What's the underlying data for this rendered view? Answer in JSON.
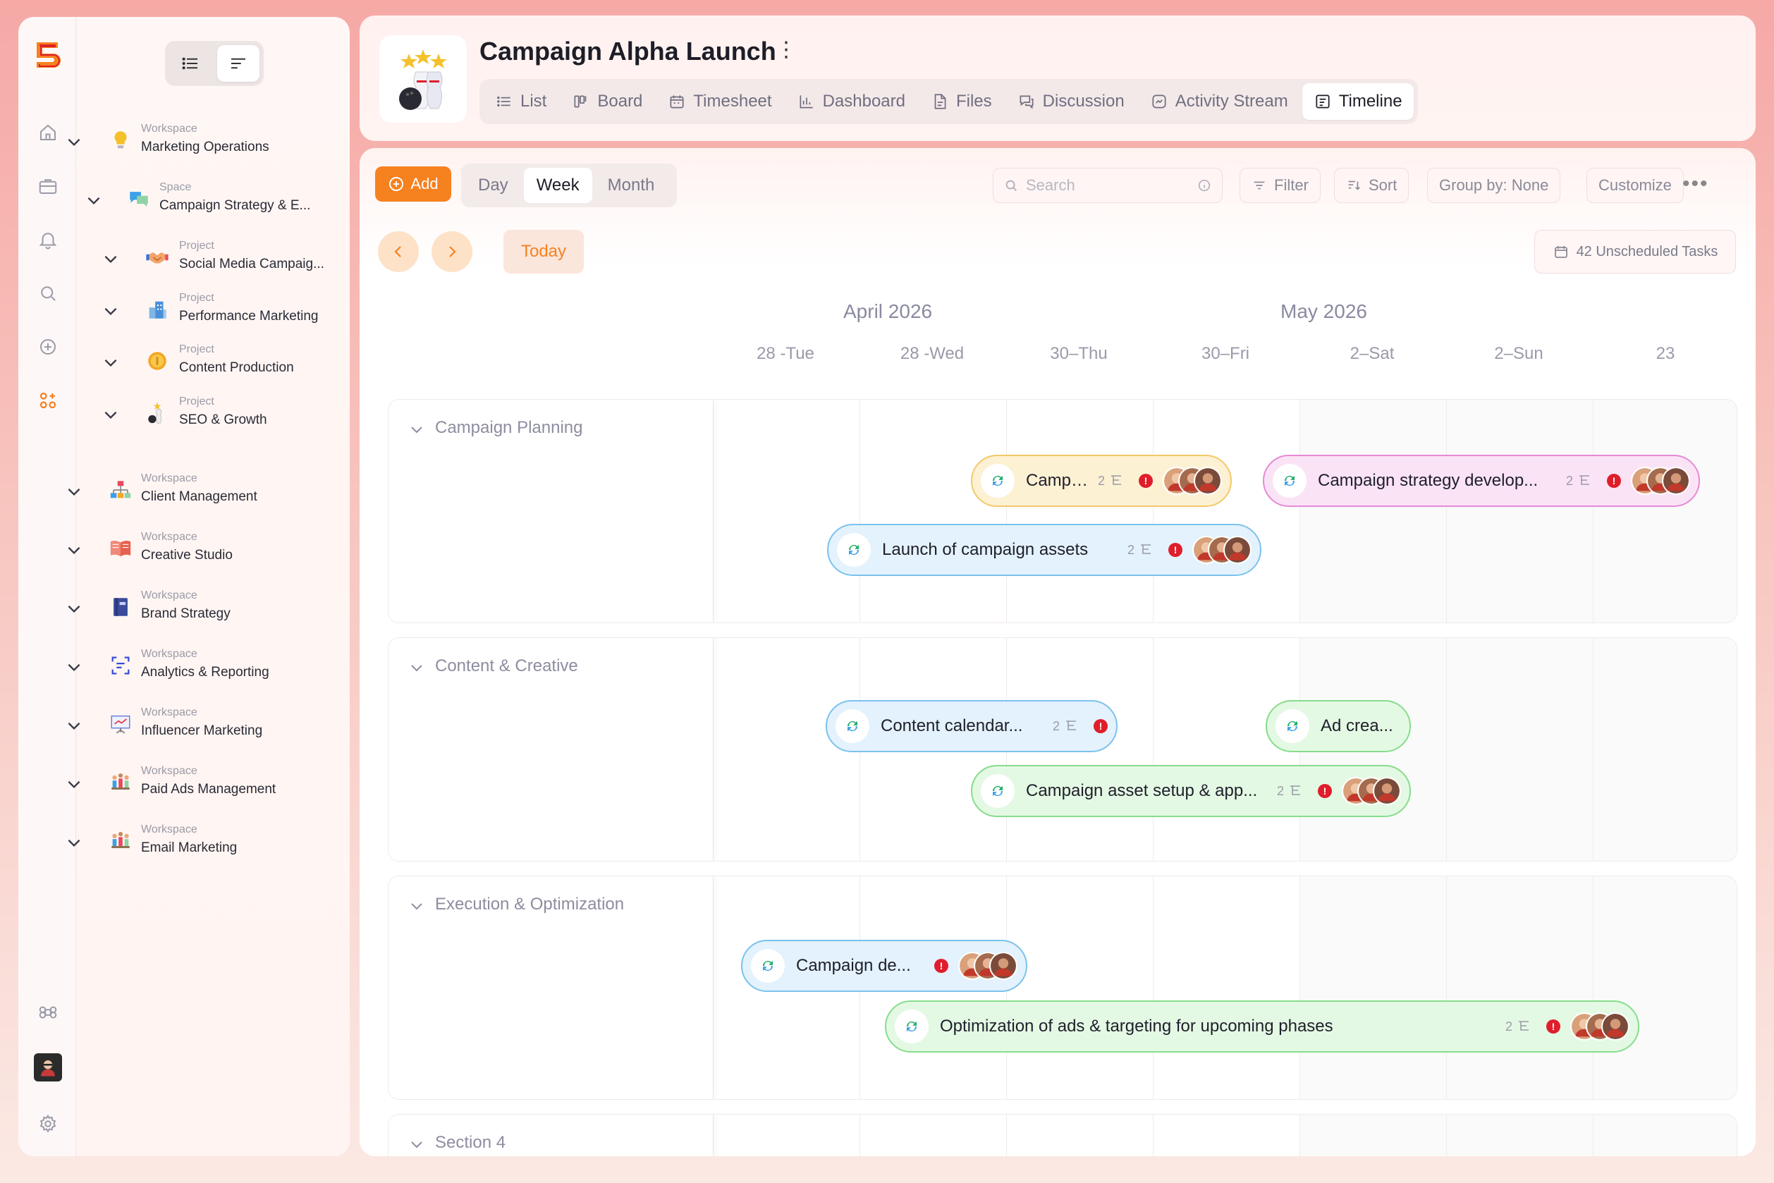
{
  "sidebar": {
    "tree": [
      {
        "kind": "Workspace",
        "name": "Marketing Operations",
        "icon": "lightbulb-icon"
      },
      {
        "kind": "Space",
        "name": "Campaign Strategy & E...",
        "icon": "chat-bubbles-icon"
      },
      {
        "kind": "Project",
        "name": "Social Media Campaig...",
        "icon": "handshake-icon"
      },
      {
        "kind": "Project",
        "name": "Performance Marketing",
        "icon": "buildings-icon"
      },
      {
        "kind": "Project",
        "name": "Content Production",
        "icon": "coin-icon"
      },
      {
        "kind": "Project",
        "name": "SEO & Growth",
        "icon": "bowling-icon"
      },
      {
        "kind": "Workspace",
        "name": "Client Management",
        "icon": "org-chart-icon"
      },
      {
        "kind": "Workspace",
        "name": "Creative Studio",
        "icon": "open-book-icon"
      },
      {
        "kind": "Workspace",
        "name": "Brand Strategy",
        "icon": "notebook-icon"
      },
      {
        "kind": "Workspace",
        "name": "Analytics & Reporting",
        "icon": "analytics-icon"
      },
      {
        "kind": "Workspace",
        "name": "Influencer Marketing",
        "icon": "presentation-icon"
      },
      {
        "kind": "Workspace",
        "name": "Paid Ads Management",
        "icon": "team-icon"
      },
      {
        "kind": "Workspace",
        "name": "Email Marketing",
        "icon": "team-icon"
      }
    ]
  },
  "header": {
    "title": "Campaign Alpha Launch",
    "tabs": [
      {
        "label": "List",
        "icon": "list-icon"
      },
      {
        "label": "Board",
        "icon": "board-icon"
      },
      {
        "label": "Timesheet",
        "icon": "calendar-icon"
      },
      {
        "label": "Dashboard",
        "icon": "chart-icon"
      },
      {
        "label": "Files",
        "icon": "file-icon"
      },
      {
        "label": "Discussion",
        "icon": "discussion-icon"
      },
      {
        "label": "Activity Stream",
        "icon": "activity-icon"
      },
      {
        "label": "Timeline",
        "icon": "timeline-icon"
      }
    ],
    "active_tab": "Timeline"
  },
  "toolbar": {
    "add_label": "Add",
    "ranges": [
      "Day",
      "Week",
      "Month"
    ],
    "active_range": "Week",
    "search_placeholder": "Search",
    "filter_label": "Filter",
    "sort_label": "Sort",
    "group_label": "Group by: None",
    "customize_label": "Customize",
    "today_label": "Today",
    "unscheduled_label": "42 Unscheduled Tasks"
  },
  "timeline": {
    "months": [
      "April 2026",
      "May 2026"
    ],
    "days": [
      "28 -Tue",
      "28 -Wed",
      "30–Thu",
      "30–Fri",
      "2–Sat",
      "2–Sun",
      "23"
    ]
  },
  "sections": [
    {
      "title": "Campaign Planning",
      "tasks": [
        {
          "label": "Campaig...",
          "count": "2",
          "color": "yellow"
        },
        {
          "label": "Campaign strategy develop...",
          "count": "2",
          "color": "pink"
        },
        {
          "label": "Launch of campaign assets",
          "count": "2",
          "color": "blue"
        }
      ]
    },
    {
      "title": "Content & Creative",
      "tasks": [
        {
          "label": "Content calendar...",
          "count": "2",
          "color": "blue"
        },
        {
          "label": "Ad crea...",
          "count": "",
          "color": "green"
        },
        {
          "label": "Campaign asset setup & app...",
          "count": "2",
          "color": "green"
        }
      ]
    },
    {
      "title": "Execution & Optimization",
      "tasks": [
        {
          "label": "Campaign de...",
          "count": "",
          "color": "blue"
        },
        {
          "label": "Optimization of ads & targeting for upcoming phases",
          "count": "2",
          "color": "green"
        }
      ]
    },
    {
      "title": "Section 4",
      "tasks": []
    }
  ],
  "colors": {
    "accent": "#f6811f",
    "yellow_bg": "#fdf1d4",
    "yellow_border": "#f4c86a",
    "pink_bg": "#fbe3f6",
    "pink_border": "#e58ad6",
    "blue_bg": "#e3f2fc",
    "blue_border": "#7cc2ee",
    "green_bg": "#e4f9e4",
    "green_border": "#86dd8c",
    "alert": "#e01e2b"
  }
}
